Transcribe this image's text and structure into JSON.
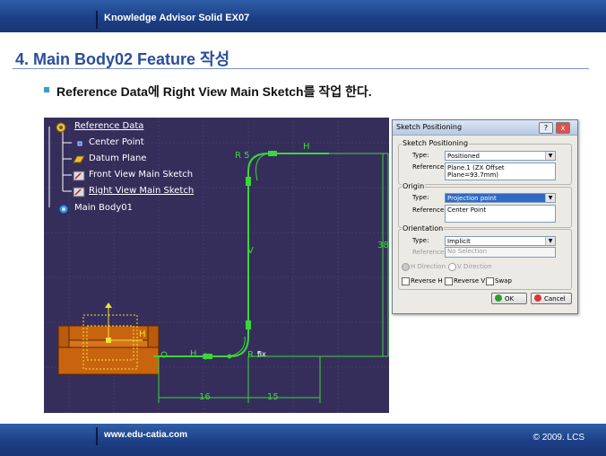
{
  "header": {
    "title": "Knowledge Advisor Solid EX07"
  },
  "slide": {
    "title": "4. Main Body02 Feature 작성",
    "bullet": "Reference Data에 Right View Main Sketch를  작업 한다."
  },
  "tree": {
    "items": [
      {
        "label": "Reference Data",
        "icon": "reference-data-icon"
      },
      {
        "label": "Center Point",
        "icon": "point-icon"
      },
      {
        "label": "Datum Plane",
        "icon": "plane-icon"
      },
      {
        "label": "Front View Main Sketch",
        "icon": "sketch-icon"
      },
      {
        "label": "Right View Main Sketch",
        "icon": "sketch-icon"
      },
      {
        "label": "Main Body01",
        "icon": "body-icon"
      }
    ]
  },
  "sketch": {
    "dim_r_top": "R 5",
    "dim_r_bottom": "R 5",
    "dim_height": "38",
    "dim_left": "16",
    "dim_right": "15",
    "label_h_top": "H",
    "label_v": "V",
    "label_h_bottom": "H",
    "label_h_part": "H",
    "label_fix": "fix"
  },
  "dialog": {
    "title": "Sketch Positioning",
    "help": "?",
    "close": "x",
    "group1": "Sketch Positioning",
    "type_label": "Type:",
    "type_value": "Positioned",
    "reference_label": "Reference:",
    "reference_value": "Plane.1 (ZX Offset Plane=93.7mm)",
    "group2": "Origin",
    "origin_type_label": "Type:",
    "origin_type_value": "Projection point",
    "origin_reference_label": "Reference:",
    "origin_reference_value": "Center Point",
    "group3": "Orientation",
    "orient_type_label": "Type:",
    "orient_type_value": "Implicit",
    "orient_reference_label": "Reference:",
    "orient_reference_value": "No Selection",
    "h_direction": "H Direction",
    "v_direction": "V Direction",
    "reverse_h": "Reverse H",
    "reverse_v": "Reverse V",
    "swap": "Swap",
    "ok": "OK",
    "cancel": "Cancel"
  },
  "footer": {
    "url": "www.edu-catia.com",
    "copyright": "© 2009. LCS"
  },
  "colors": {
    "sketch_green": "#3bd63b",
    "viewport_bg": "#362e5a",
    "part_orange": "#c8640f",
    "title_blue": "#2a4e9a"
  }
}
